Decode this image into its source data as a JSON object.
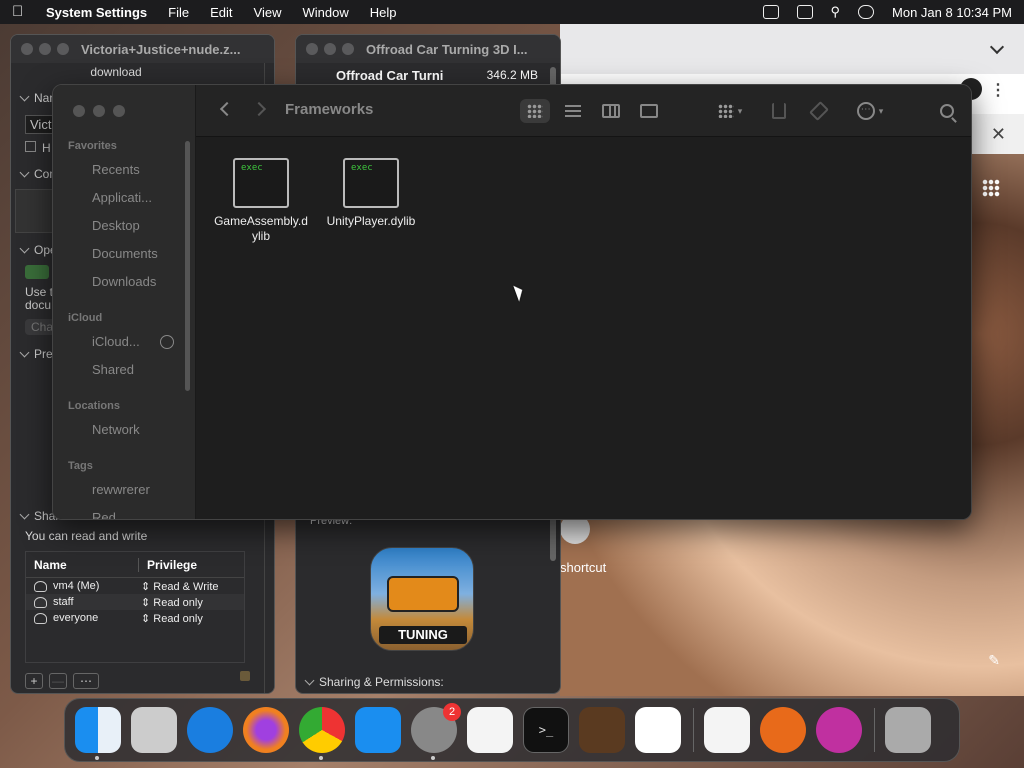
{
  "menubar": {
    "apple_icon": "apple-icon",
    "app_name": "System Settings",
    "menus": [
      "File",
      "Edit",
      "View",
      "Window",
      "Help"
    ],
    "datetime": "Mon Jan 8  10:34 PM"
  },
  "info_window_1": {
    "title": "Victoria+Justice+nude.z...",
    "subtitle": "download",
    "sections": {
      "name": "Nam",
      "name_value": "Victo",
      "hide_ext": "H",
      "comments": "Com",
      "open_with": "Ope",
      "use_text": "Use t",
      "docu_text": "docu",
      "change": "Cha",
      "preview": "Prev",
      "sharing": "Shar"
    },
    "can_read_write": "You can read and write",
    "table": {
      "headers": [
        "Name",
        "Privilege"
      ],
      "rows": [
        {
          "name": "vm4 (Me)",
          "privilege": "Read & Write"
        },
        {
          "name": "staff",
          "privilege": "Read only"
        },
        {
          "name": "everyone",
          "privilege": "Read only"
        }
      ]
    }
  },
  "info_window_2": {
    "title": "Offroad Car Turning 3D I...",
    "app_name": "Offroad Car Turni",
    "size": "346.2 MB",
    "preview_label": "Preview:",
    "icon_label": "TUNING",
    "sharing_label": "Sharing & Permissions:"
  },
  "finder": {
    "title": "Frameworks",
    "sidebar": {
      "favorites_label": "Favorites",
      "favorites": [
        "Recents",
        "Applicati...",
        "Desktop",
        "Documents",
        "Downloads"
      ],
      "icloud_label": "iCloud",
      "icloud": [
        "iCloud...",
        "Shared"
      ],
      "locations_label": "Locations",
      "locations": [
        "Network"
      ],
      "tags_label": "Tags",
      "tags": [
        "rewwrerer",
        "Red"
      ]
    },
    "files": [
      {
        "name": "GameAssembly.dylib",
        "name_line1": "GameAssembly.d",
        "name_line2": "ylib",
        "icon_text": "exec"
      },
      {
        "name": "UnityPlayer.dylib",
        "name_line1": "UnityPlayer.dylib",
        "name_line2": "",
        "icon_text": "exec"
      }
    ]
  },
  "browser": {
    "shortcut_text": "shortcut"
  },
  "dock": {
    "apps": [
      "Finder",
      "Launchpad",
      "Safari",
      "Firefox",
      "Chrome",
      "App Store",
      "System Settings",
      "TextEdit",
      "Terminal",
      "GarageBand",
      "Visual Studio Code",
      "iMovie",
      "Instruments",
      "Migration",
      "Trash"
    ],
    "settings_badge": "2"
  }
}
